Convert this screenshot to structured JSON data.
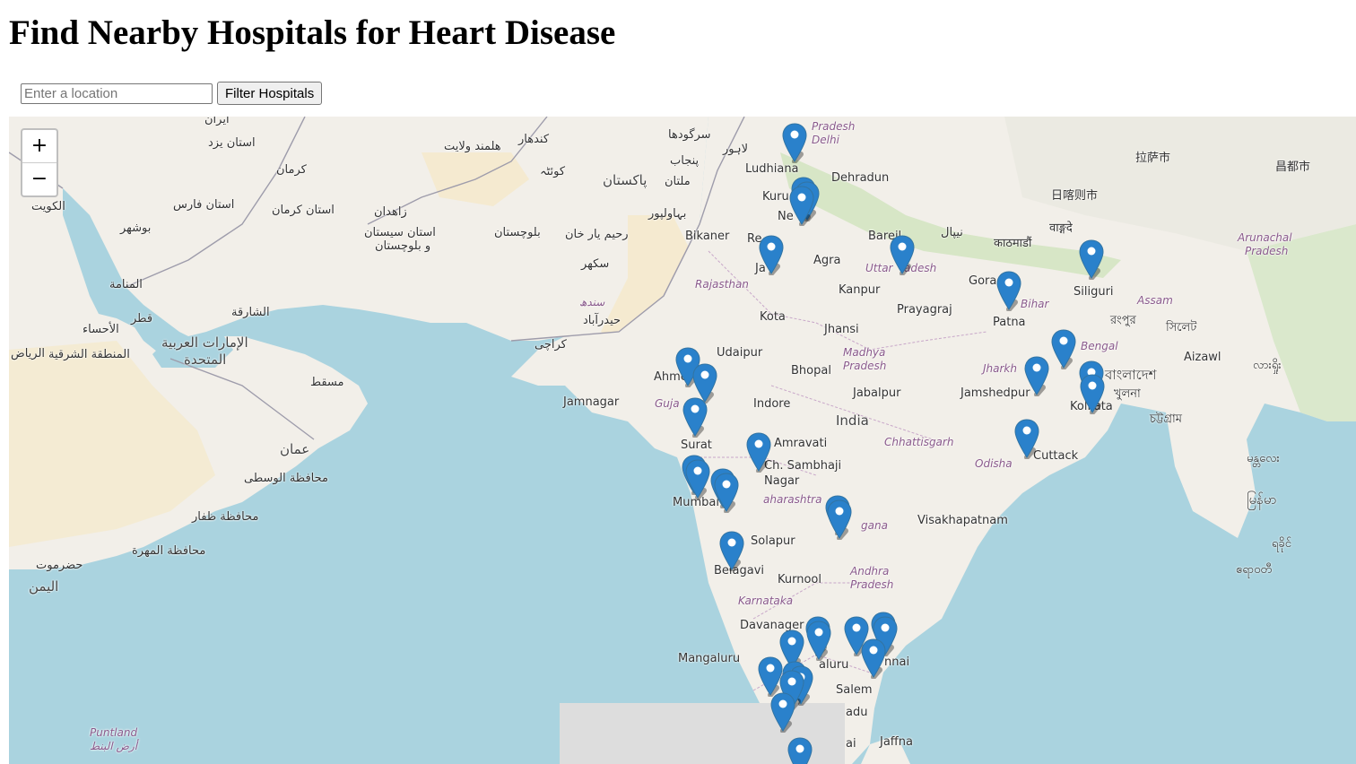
{
  "page": {
    "title": "Find Nearby Hospitals for Heart Disease"
  },
  "controls": {
    "location_placeholder": "Enter a location",
    "location_value": "",
    "filter_button": "Filter Hospitals"
  },
  "map": {
    "zoom_in": "+",
    "zoom_out": "−",
    "marker_icon": "map-pin-icon",
    "marker_color": "#2a81cb",
    "water_color": "#aad3df",
    "land_color": "#f2efe9",
    "place_labels": [
      "Ludhiana",
      "Dehradun",
      "Kuru",
      "Ne",
      "Bikaner",
      "Re",
      "Ja",
      "Agra",
      "Bareil",
      "Kanpur",
      "Rajasthan",
      "Prayagraj",
      "Gora",
      "Patna",
      "Siliguri",
      "Kota",
      "Jhansi",
      "Udaipur",
      "Ahme",
      "Bhopal",
      "Madhya",
      "Pradesh",
      "Jabalpur",
      "Jamshedpur",
      "Kolkata",
      "Jamnagar",
      "Guja",
      "Indore",
      "India",
      "Surat",
      "Amravati",
      "Ch. Sambhaji",
      "Nagar",
      "Chhattisgarh",
      "Odisha",
      "Cuttack",
      "Mumbai",
      "aharashtra",
      "Visakhapatnam",
      "Solapur",
      "gana",
      "Belagavi",
      "Kurnool",
      "Andhra",
      "Pradesh",
      "Karnataka",
      "Davanager",
      "Mangaluru",
      "aluru",
      "nnai",
      "Salem",
      "Jaffna",
      "adu",
      "ai",
      "Uttar",
      "adesh",
      "Bihar",
      "Jharkh",
      "Bengal",
      "Assam",
      "Arunachal",
      "Pradesh",
      "Aizawl",
      "Puntland",
      "Delhi",
      "Pradesh"
    ],
    "foreign_labels": [
      "ایران",
      "استان یزد",
      "کرمان",
      "استان کرمان",
      "استان فارس",
      "الكويت",
      "بوشهر",
      "المنامة",
      "قطر",
      "الإمارات العربية",
      "المتحدة",
      "الشارقة",
      "الرياض",
      "الأحساء",
      "المنطقة الشرقية",
      "مسقط",
      "عمان",
      "محافظة الوسطى",
      "محافظة ظفار",
      "محافظة المهرة",
      "حضرموت",
      "اليمن",
      "أرض البنط",
      "زاهدان",
      "استان سیستان",
      "و بلوچستان",
      "بلوچستان",
      "کندهار",
      "هلمند ولايت",
      "کوئٹہ",
      "پاکستان",
      "ملتان",
      "بہاولپور",
      "رحیم یار خان",
      "سکھر",
      "سندھ",
      "حیدرآباد",
      "کراچی",
      "سرگودھا",
      "پنجاب",
      "لاہور",
      "نیپال",
      "काठमाडौं",
      "拉萨市",
      "日喀则市",
      "昌都市",
      "वाङ्गदे",
      "বাংলাদেশ",
      "খুলনা",
      "চট্টগ্রাম",
      "রংপুর",
      "সিলেট",
      "မြန်မာ",
      "ရခိုင်",
      "ဧရာဝတီ",
      "မန္တလေး",
      "လားရှိုး"
    ]
  }
}
